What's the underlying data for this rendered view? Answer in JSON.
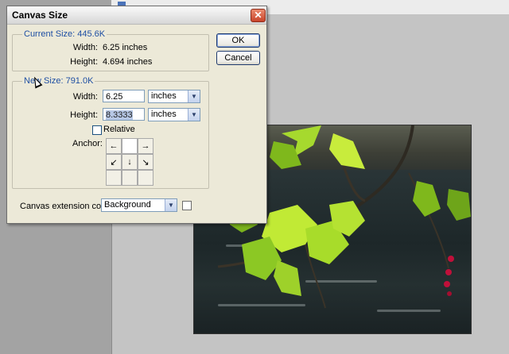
{
  "dialog": {
    "title": "Canvas Size",
    "close_glyph": "✕",
    "current_size": {
      "legend": "Current Size: 445.6K",
      "width_label": "Width:",
      "width_value": "6.25 inches",
      "height_label": "Height:",
      "height_value": "4.694 inches"
    },
    "new_size": {
      "legend": "New Size: 791.0K",
      "width_label": "Width:",
      "width_value": "6.25",
      "width_unit": "inches",
      "height_label": "Height:",
      "height_value": "8.3333",
      "height_unit": "inches",
      "relative_label": "Relative",
      "relative_checked": false,
      "anchor_label": "Anchor:",
      "anchor_arrows": [
        "←",
        "",
        "→",
        "↙",
        "↓",
        "↘",
        "",
        "",
        ""
      ]
    },
    "canvas_extension_label": "Canvas extension color:",
    "canvas_extension_value": "Background",
    "ok_label": "OK",
    "cancel_label": "Cancel",
    "dropdown_glyph": "▼"
  },
  "icons": {
    "close": "close-icon",
    "dropdown": "chevron-down-icon",
    "cursor": "mouse-pointer-icon"
  },
  "colors": {
    "dialog_bg": "#ece9d8",
    "legend_text": "#1f4fa3",
    "workspace_bg": "#c4c4c4",
    "close_button": "#c9442a"
  }
}
